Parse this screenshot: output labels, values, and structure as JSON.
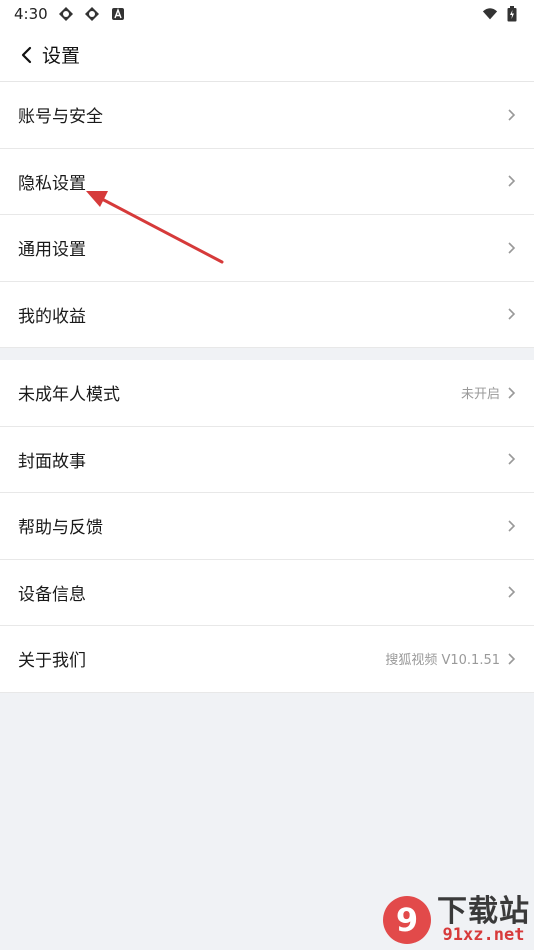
{
  "status_bar": {
    "time": "4:30",
    "icons": [
      "app-icon",
      "app-icon",
      "a-notification-icon"
    ],
    "right_icons": [
      "wifi-icon",
      "battery-icon"
    ]
  },
  "header": {
    "title": "设置",
    "back_icon": "chevron-left-icon"
  },
  "group1": [
    {
      "label": "账号与安全",
      "value": ""
    },
    {
      "label": "隐私设置",
      "value": ""
    },
    {
      "label": "通用设置",
      "value": ""
    },
    {
      "label": "我的收益",
      "value": ""
    }
  ],
  "group2": [
    {
      "label": "未成年人模式",
      "value": "未开启"
    },
    {
      "label": "封面故事",
      "value": ""
    },
    {
      "label": "帮助与反馈",
      "value": ""
    },
    {
      "label": "设备信息",
      "value": ""
    },
    {
      "label": "关于我们",
      "value": "搜狐视频 V10.1.51"
    }
  ],
  "annotation": {
    "color": "#d63a3a"
  },
  "watermark": {
    "main": "下载站",
    "sub": "91xz.net",
    "logo_text": "9"
  },
  "colors": {
    "background": "#f0f2f5",
    "row_bg": "#ffffff",
    "accent_red": "#d73a3a"
  }
}
